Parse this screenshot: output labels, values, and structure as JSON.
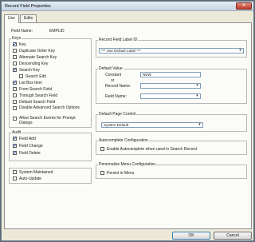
{
  "window": {
    "title": "Record Field Properties",
    "close_glyph": "✕"
  },
  "tabs": [
    {
      "label": "Use"
    },
    {
      "label": "Edits"
    }
  ],
  "field_name": {
    "label": "Field Name:",
    "value": "EMPLID"
  },
  "keys_group": {
    "label": "Keys",
    "items": [
      {
        "label": "Key",
        "checked": true
      },
      {
        "label": "Duplicate Order Key",
        "checked": false
      },
      {
        "label": "Alternate Search Key",
        "checked": false
      },
      {
        "label": "Descending Key",
        "checked": false
      },
      {
        "label": "Search Key",
        "checked": true
      },
      {
        "label": "Search Edit",
        "checked": false
      },
      {
        "label": "List Box Item",
        "checked": true
      },
      {
        "label": "From Search Field",
        "checked": false
      },
      {
        "label": "Through Search Field",
        "checked": false
      },
      {
        "label": "Default Search Field",
        "checked": false
      },
      {
        "label": "Disable Advanced Search Options",
        "checked": false
      },
      {
        "label": "Allow Search Events for Prompt Dialogs",
        "checked": false
      }
    ]
  },
  "audit_group": {
    "label": "Audit",
    "items": [
      {
        "label": "Field Add",
        "checked": true
      },
      {
        "label": "Field Change",
        "checked": true
      },
      {
        "label": "Field Delete",
        "checked": true
      }
    ]
  },
  "misc_checks": [
    {
      "label": "System Maintained",
      "checked": false
    },
    {
      "label": "Auto-Update",
      "checked": false
    }
  ],
  "record_field_label_group": {
    "label": "Record Field Label ID",
    "selected": "*** Use Default Label ***"
  },
  "default_value_group": {
    "label": "Default Value",
    "constant_label": "Constant",
    "constant_value": "NEW",
    "or_label": "or",
    "record_name_label": "Record Name:",
    "record_name_value": "",
    "field_name_label": "Field Name:",
    "field_name_value": ""
  },
  "default_page_control_group": {
    "label": "Default Page Control",
    "selected": "System Default"
  },
  "autocomplete_group": {
    "label": "Autocomplete Configuration",
    "checkbox_label": "Enable Autocomplete when used in Search Record",
    "checked": false
  },
  "pers_menu_group": {
    "label": "Personalize Menu Configuration",
    "checkbox_label": "Persist in Menu",
    "checked": false
  },
  "buttons": {
    "ok": "OK",
    "cancel": "Cancel"
  },
  "icons": {
    "dropdown": "chevron-down-icon",
    "resize": "resize-grip-icon"
  }
}
